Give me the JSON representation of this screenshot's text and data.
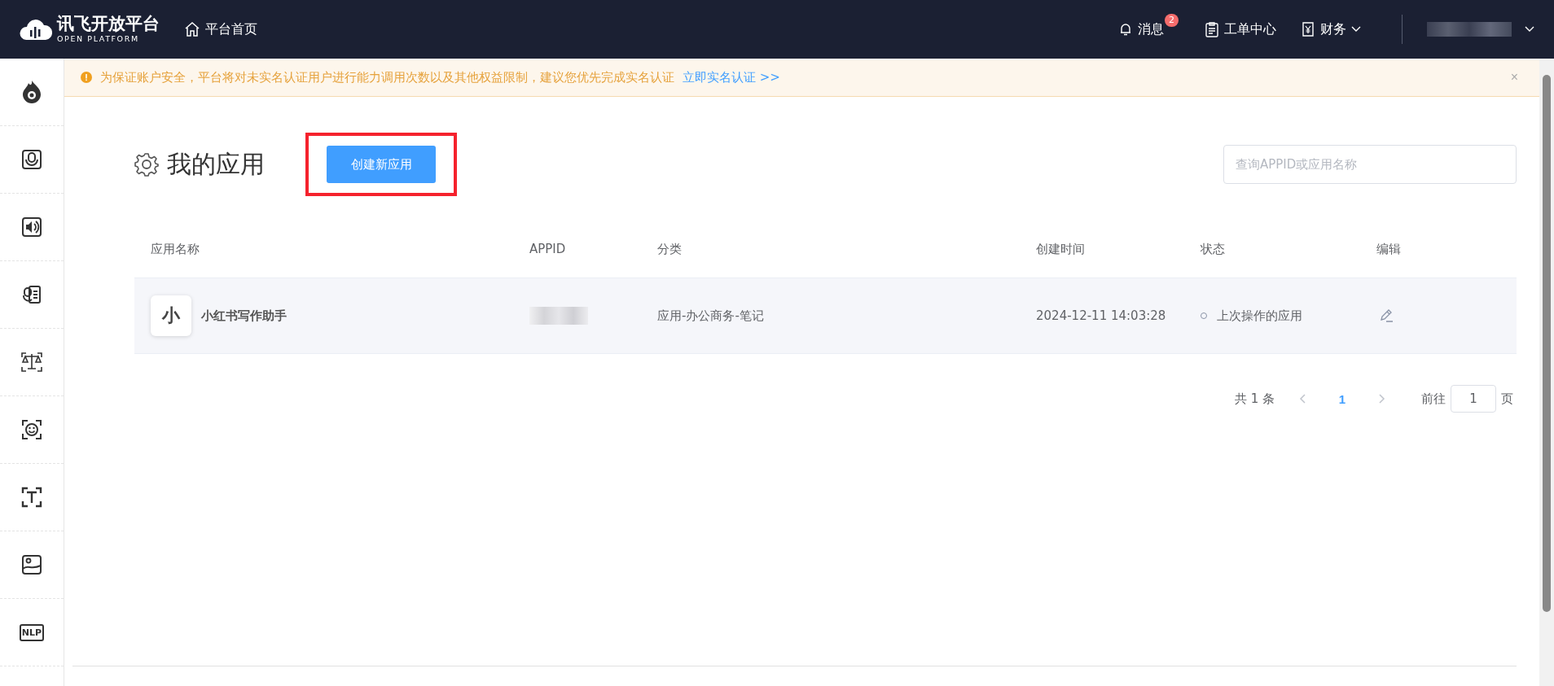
{
  "topbar": {
    "logo_title": "讯飞开放平台",
    "logo_subtitle": "OPEN PLATFORM",
    "home_link": "平台首页",
    "messages": {
      "label": "消息",
      "badge": "2"
    },
    "tickets": "工单中心",
    "finance": "财务"
  },
  "sidebar": {
    "items": [
      {
        "kind": "flame"
      },
      {
        "kind": "mic"
      },
      {
        "kind": "speaker"
      },
      {
        "kind": "reader"
      },
      {
        "kind": "scale"
      },
      {
        "kind": "face"
      },
      {
        "kind": "text"
      },
      {
        "kind": "image"
      },
      {
        "kind": "nlp",
        "text": "NLP"
      }
    ]
  },
  "notice": {
    "text": "为保证账户安全，平台将对未实名认证用户进行能力调用次数以及其他权益限制，建议您优先完成实名认证",
    "link": "立即实名认证 >>",
    "close": "×"
  },
  "page": {
    "title": "我的应用",
    "create_button": "创建新应用",
    "create_highlighted": true,
    "search": {
      "placeholder": "查询APPID或应用名称"
    }
  },
  "table": {
    "columns": [
      "应用名称",
      "APPID",
      "分类",
      "创建时间",
      "状态",
      "编辑"
    ],
    "rows": [
      {
        "avatar": "小",
        "name": "小红书写作助手",
        "category": "应用-办公商务-笔记",
        "created": "2024-12-11 14:03:28",
        "status": "上次操作的应用"
      }
    ]
  },
  "pagination": {
    "total": "共 1 条",
    "pages": [
      {
        "label": "1",
        "selected": true
      }
    ],
    "goto_label": "前往",
    "goto_value": "1",
    "page_suffix": "页"
  }
}
